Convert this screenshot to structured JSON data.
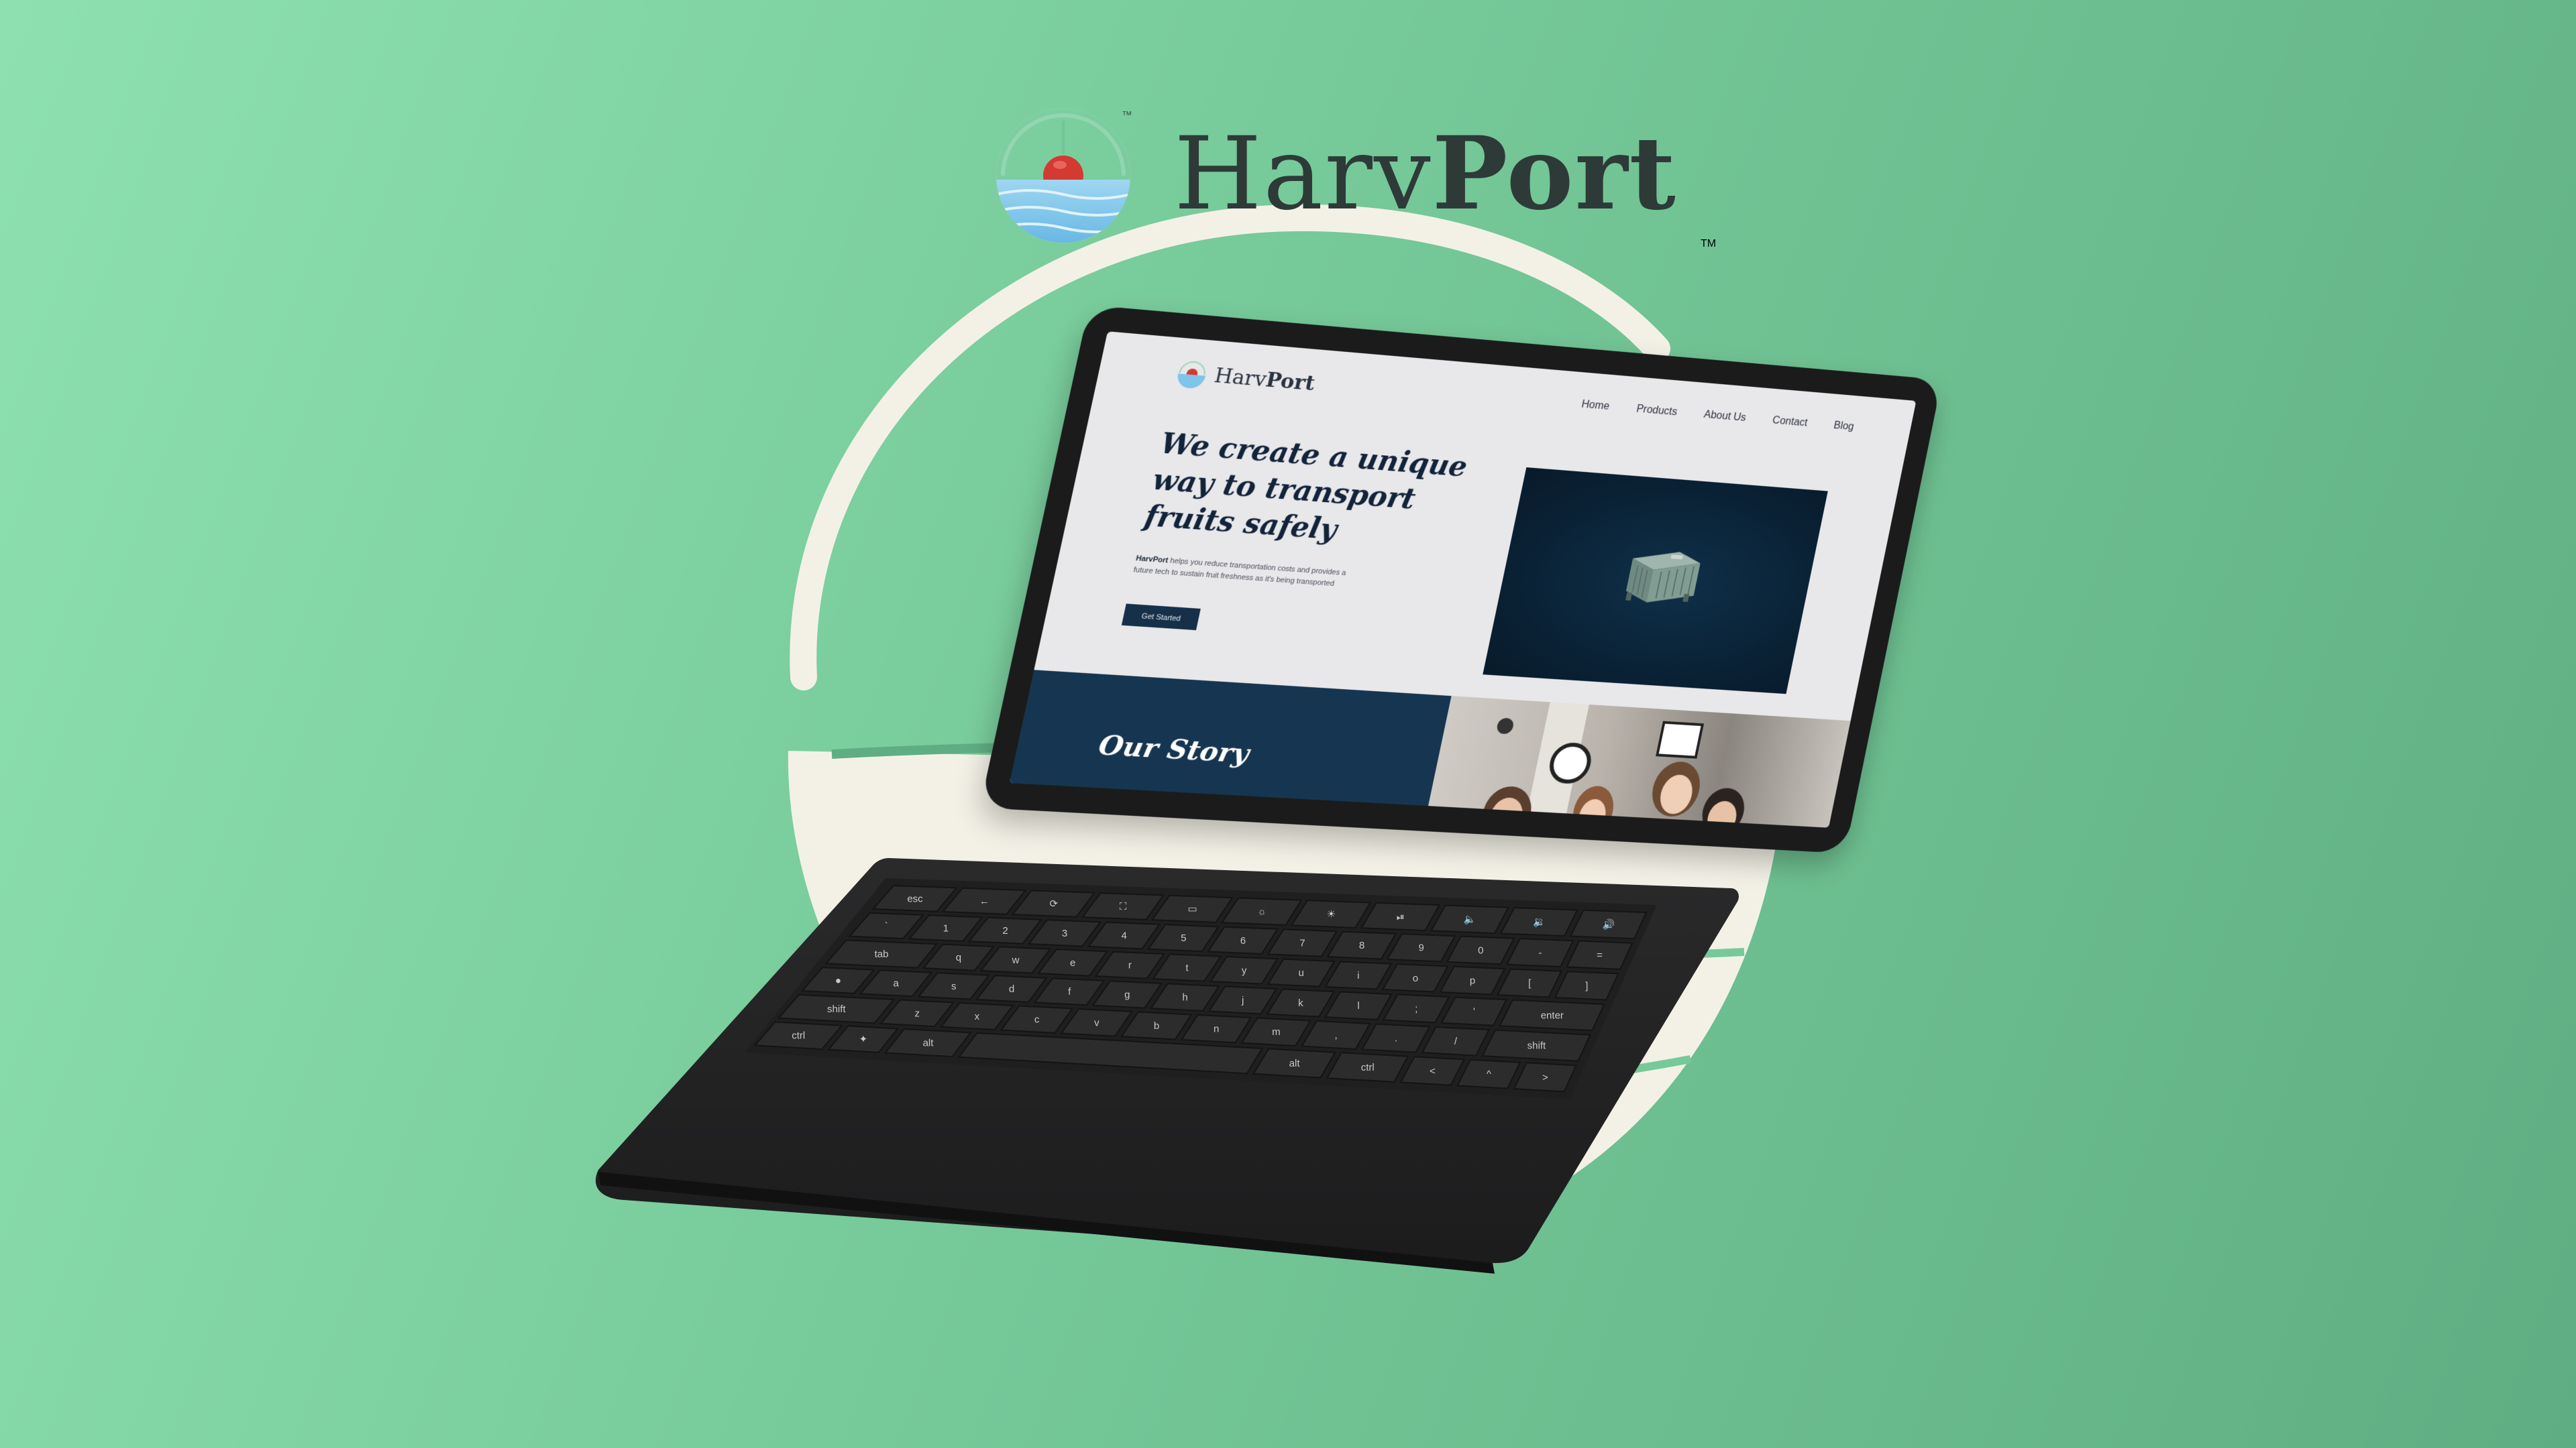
{
  "brand": {
    "wordmark_regular": "Harv",
    "wordmark_bold": "Port",
    "tm_small": "™",
    "tm_large": "TM"
  },
  "colors": {
    "background_light": "#8ee0b0",
    "background_dark": "#5fae83",
    "navy": "#163550",
    "apple_red": "#d33a32",
    "water_blue": "#7fc4ea",
    "laptop_body": "#1b1b1c"
  },
  "website": {
    "logo_text_regular": "Harv",
    "logo_text_bold": "Port",
    "nav": [
      "Home",
      "Products",
      "About Us",
      "Contact",
      "Blog"
    ],
    "hero_title": "We create a unique way to transport fruits safely",
    "hero_sub_brand": "HarvPort",
    "hero_sub_text": " helps you reduce transportation costs and provides a future tech to sustain fruit freshness as it's being transported",
    "cta_label": "Get Started",
    "story_title": "Our Story"
  },
  "keyboard": {
    "row_fn": [
      "esc",
      "←",
      "⟳",
      "⛶",
      "▭",
      "☼",
      "☀",
      "⏯",
      "🔈",
      "🔉",
      "🔊"
    ],
    "row_num": [
      "`",
      "1",
      "2",
      "3",
      "4",
      "5",
      "6",
      "7",
      "8",
      "9",
      "0",
      "-",
      "="
    ],
    "row_q": [
      "tab",
      "q",
      "w",
      "e",
      "r",
      "t",
      "y",
      "u",
      "i",
      "o",
      "p",
      "[",
      "]"
    ],
    "row_a": [
      "●",
      "a",
      "s",
      "d",
      "f",
      "g",
      "h",
      "j",
      "k",
      "l",
      ";",
      "'",
      "enter"
    ],
    "row_z": [
      "shift",
      "z",
      "x",
      "c",
      "v",
      "b",
      "n",
      "m",
      ",",
      ".",
      "/",
      "shift"
    ],
    "row_space": [
      "ctrl",
      "✦",
      "alt",
      "",
      "alt",
      "ctrl",
      "<",
      "^",
      ">"
    ]
  }
}
